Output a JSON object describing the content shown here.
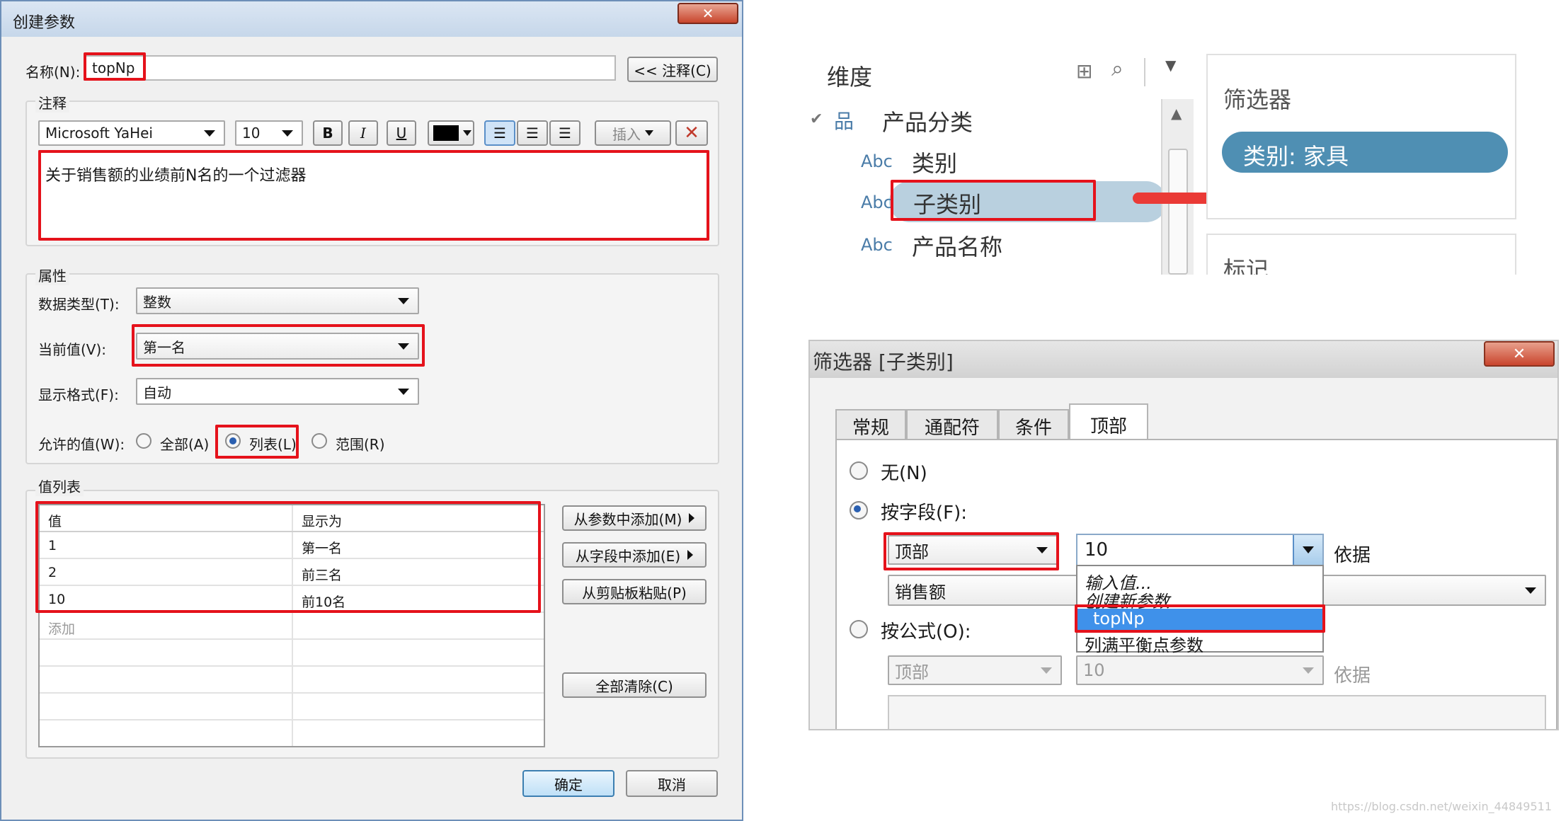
{
  "dialog": {
    "title": "创建参数",
    "name_label": "名称(N):",
    "name_value": "topNp",
    "comment_button": "<< 注释(C)",
    "comment_group": "注释",
    "font_name": "Microsoft YaHei",
    "font_size": "10",
    "bold": "B",
    "italic": "I",
    "underline": "U",
    "insert": "插入",
    "comment_text": "关于销售额的业绩前N名的一个过滤器",
    "props_group": "属性",
    "datatype_label": "数据类型(T):",
    "datatype_value": "整数",
    "current_label": "当前值(V):",
    "current_value": "第一名",
    "format_label": "显示格式(F):",
    "format_value": "自动",
    "allowed_label": "允许的值(W):",
    "allowed_all": "全部(A)",
    "allowed_list": "列表(L)",
    "allowed_range": "范围(R)",
    "list_group": "值列表",
    "col_value": "值",
    "col_display": "显示为",
    "rows": [
      {
        "value": "1",
        "display": "第一名"
      },
      {
        "value": "2",
        "display": "前三名"
      },
      {
        "value": "10",
        "display": "前10名"
      }
    ],
    "add_placeholder": "添加",
    "add_from_param": "从参数中添加(M)",
    "add_from_field": "从字段中添加(E)",
    "paste_clipboard": "从剪贴板粘贴(P)",
    "clear_all": "全部清除(C)",
    "ok": "确定",
    "cancel": "取消",
    "close": "✕"
  },
  "data_pane": {
    "title": "维度",
    "hierarchy": "产品分类",
    "fields": [
      "类别",
      "子类别",
      "产品名称"
    ],
    "abc": "Abc"
  },
  "filters_pane": {
    "title": "筛选器",
    "pill": "类别: 家具",
    "marks": "标记"
  },
  "filter_dialog": {
    "title": "筛选器 [子类别]",
    "tabs": [
      "常规",
      "通配符",
      "条件",
      "顶部"
    ],
    "none": "无(N)",
    "by_field": "按字段(F):",
    "by_formula": "按公式(O):",
    "top": "顶部",
    "count": "10",
    "by": "依据",
    "measure": "销售额",
    "menu": [
      "输入值...",
      "创建新参数...",
      "topNp",
      "列满平衡点参数"
    ],
    "close": "✕"
  },
  "watermark": "https://blog.csdn.net/weixin_44849511"
}
